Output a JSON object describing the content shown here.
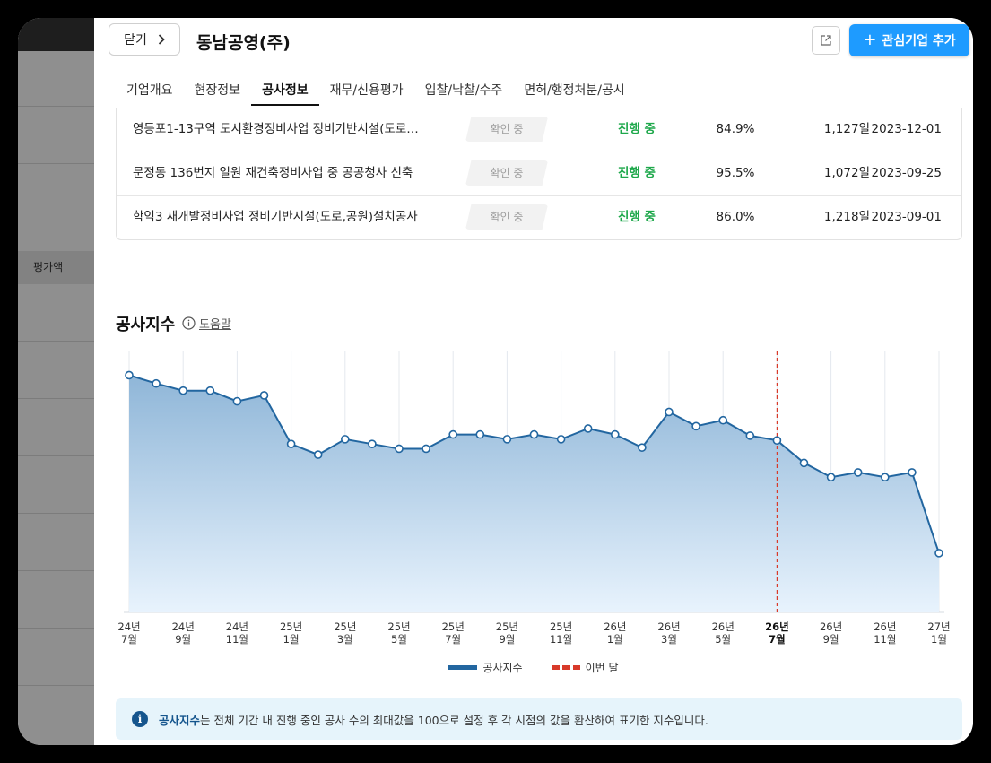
{
  "left_pane": {
    "label": "평가액"
  },
  "header": {
    "close_label": "닫기",
    "company": "동남공영(주)",
    "favorite_label": "관심기업 추가"
  },
  "tabs": [
    {
      "label": "기업개요",
      "active": false
    },
    {
      "label": "현장정보",
      "active": false
    },
    {
      "label": "공사정보",
      "active": true
    },
    {
      "label": "재무/신용평가",
      "active": false
    },
    {
      "label": "입찰/낙찰/수주",
      "active": false
    },
    {
      "label": "면허/행정처분/공시",
      "active": false
    }
  ],
  "projects": [
    {
      "name": "영등포1-13구역 도시환경정비사업 정비기반시설(도로…",
      "badge": "확인 중",
      "status": "진행 중",
      "rate": "84.9%",
      "days": "1,127일",
      "date": "2023-12-01"
    },
    {
      "name": "문정동 136번지 일원 재건축정비사업 중 공공청사 신축",
      "badge": "확인 중",
      "status": "진행 중",
      "rate": "95.5%",
      "days": "1,072일",
      "date": "2023-09-25"
    },
    {
      "name": "학익3 재개발정비사업 정비기반시설(도로,공원)설치공사",
      "badge": "확인 중",
      "status": "진행 중",
      "rate": "86.0%",
      "days": "1,218일",
      "date": "2023-09-01"
    }
  ],
  "index_section": {
    "title": "공사지수",
    "help_label": "도움말"
  },
  "chart_data": {
    "type": "line",
    "tick_labels": [
      [
        "24년",
        "7월"
      ],
      [
        "24년",
        "9월"
      ],
      [
        "24년",
        "11월"
      ],
      [
        "25년",
        "1월"
      ],
      [
        "25년",
        "3월"
      ],
      [
        "25년",
        "5월"
      ],
      [
        "25년",
        "7월"
      ],
      [
        "25년",
        "9월"
      ],
      [
        "25년",
        "11월"
      ],
      [
        "26년",
        "1월"
      ],
      [
        "26년",
        "3월"
      ],
      [
        "26년",
        "5월"
      ],
      [
        "26년",
        "7월"
      ],
      [
        "26년",
        "9월"
      ],
      [
        "26년",
        "11월"
      ],
      [
        "27년",
        "1월"
      ]
    ],
    "current_tick": 12,
    "series": [
      {
        "name": "공사지수",
        "values": [
          100,
          96.5,
          93.5,
          93.5,
          89,
          91.5,
          71,
          66.5,
          73,
          71,
          69,
          69,
          75,
          75,
          73,
          75,
          73,
          77.5,
          75,
          69.5,
          84.5,
          78.5,
          81,
          74.5,
          72.5,
          63,
          57,
          59,
          57,
          59,
          25
        ]
      }
    ],
    "current_month_index": 24,
    "ylim": [
      0,
      110
    ],
    "legend": [
      {
        "label": "공사지수",
        "style": "line",
        "color": "#2266a0"
      },
      {
        "label": "이번 달",
        "style": "dashed",
        "color": "#d83a2a"
      }
    ],
    "grid": true,
    "legend_position": "bottom"
  },
  "info": {
    "strong": "공사지수",
    "text": "는 전체 기간 내 진행 중인 공사 수의 최대값을 100으로 설정 후 각 시점의 값을 환산하여 표기한 지수입니다."
  },
  "colors": {
    "accent": "#1e9bff",
    "status_green": "#1ea84b",
    "series": "#2266a0",
    "current_marker": "#d83a2a"
  }
}
